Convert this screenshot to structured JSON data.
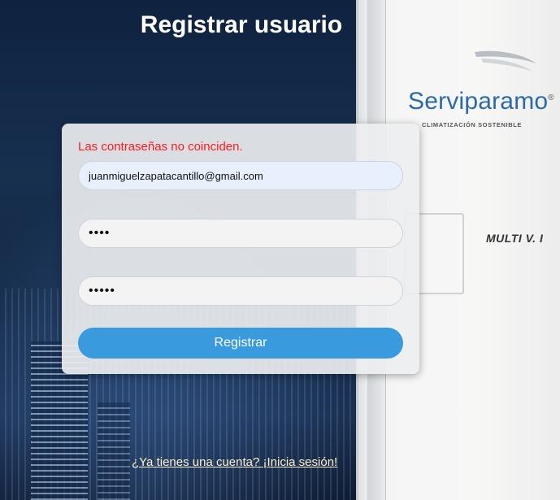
{
  "page": {
    "title": "Registrar usuario"
  },
  "background": {
    "brand_name": "Serviparamo",
    "brand_registered": "®",
    "brand_tagline": "CLIMATIZACIÓN SOSTENIBLE",
    "product_label": "MULTI V. I"
  },
  "form": {
    "error_message": "Las contraseñas no coinciden.",
    "email_value": "juanmiguelzapatacantillo@gmail.com",
    "password_value": "1234",
    "confirm_password_value": "12345",
    "submit_label": "Registrar"
  },
  "footer": {
    "login_link": "¿Ya tienes una cuenta? ¡Inicia sesión!"
  },
  "colors": {
    "accent": "#3a9ade",
    "error": "#ff1a1a",
    "brand": "#2a6aa6",
    "link": "#fdf1c8"
  }
}
